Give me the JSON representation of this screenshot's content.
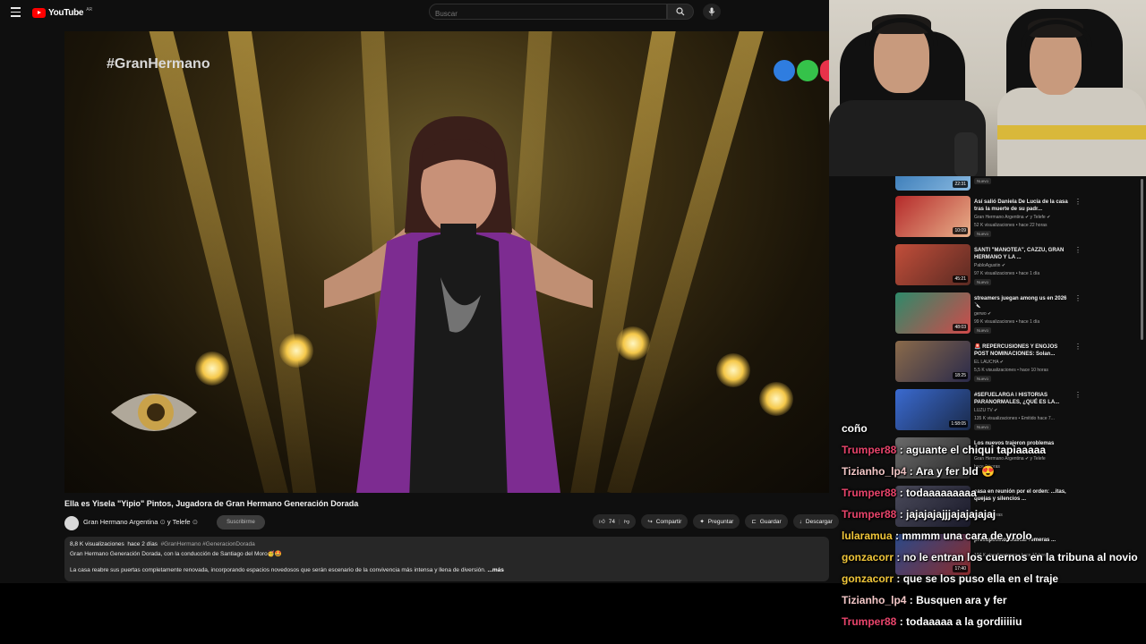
{
  "header": {
    "logo_text": "YouTube",
    "logo_region": "AR",
    "search_placeholder": "Buscar"
  },
  "video": {
    "overlay_hashtag": "#GranHermano",
    "title": "Ella es Yisela \"Yipio\" Pintos, Jugadora de Gran Hermano Generación Dorada",
    "channel": "Gran Hermano Argentina",
    "channel_extra": "y Telefe",
    "subscribe_label": "Suscribirme",
    "likes": "74",
    "share_label": "Compartir",
    "ask_label": "Preguntar",
    "save_label": "Guardar",
    "download_label": "Descargar",
    "views": "8,8 K visualizaciones",
    "age": "hace 2 días",
    "hashtags": "#GranHermano #GeneracionDorada",
    "desc_line1": "Gran Hermano Generación Dorada, con la conducción de Santiago del Moro🥳🤩",
    "desc_line2": "La casa reabre sus puertas completamente renovada, incorporando espacios novedosos que serán escenario de la convivencia más intensa y llena de diversión.",
    "more_label": "...más"
  },
  "recommendations": [
    {
      "title": "",
      "channel": "",
      "stats": "",
      "duration": "22:31",
      "badge": "Nuevo"
    },
    {
      "title": "Así salió Daniela De Lucía de la casa tras la muerte de su padr...",
      "channel": "Gran Hermano Argentina ✔ y Telefe ✔",
      "stats": "52 K visualizaciones • hace 22 horas",
      "duration": "10:09",
      "badge": "Nuevo"
    },
    {
      "title": "SANTI \"MANOTEA\", CAZZU, GRAN HERMANO Y LA ...",
      "channel": "PabloAgustin ✔",
      "stats": "97 K visualizaciones • hace 1 día",
      "duration": "45:21",
      "badge": "Nuevo"
    },
    {
      "title": "streamers juegan among us en 2026 🔪",
      "channel": "gerwo ✔",
      "stats": "99 K visualizaciones • hace 1 día",
      "duration": "48:03",
      "badge": "Nuevo"
    },
    {
      "title": "🚨 REPERCUSIONES Y ENOJOS POST NOMINACIONES: Solan...",
      "channel": "EL LAUCHA ✔",
      "stats": "5,5 K visualizaciones • hace 10 horas",
      "duration": "18:25",
      "badge": "Nuevo"
    },
    {
      "title": "#SEFUELARGA I HISTORIAS PARANORMALES, ¿QUÉ ES LA...",
      "channel": "LUZU TV ✔",
      "stats": "135 K visualizaciones • Emitido hace 7...",
      "duration": "1:58:05",
      "badge": "Nuevo"
    },
    {
      "title": "Los nuevos trajeron problemas",
      "channel": "Gran Hermano Argentina ✔ y Telefe",
      "stats": "hace 9 horas",
      "duration": "",
      "badge": ""
    },
    {
      "title": "casa en reunión por el orden: ...itas, quejas y silencios ...",
      "channel": "",
      "stats": "hace 10 horas",
      "duration": "",
      "badge": ""
    },
    {
      "title": "presupuesto: buscar remeras ...",
      "channel": "",
      "stats": "107 K visualizaciones • hace 10 horas",
      "duration": "17:40",
      "badge": ""
    }
  ],
  "chat": [
    {
      "user": "",
      "message": "coño",
      "color": "#ffffff"
    },
    {
      "user": "Trumper88",
      "message": "aguante el chiqui tapiaaaaa",
      "color": "#e8446b"
    },
    {
      "user": "Tizianho_lp4",
      "message": "Ara y fer bld 😍",
      "color": "#f2c6c6"
    },
    {
      "user": "Trumper88",
      "message": "todaaaaaaaaa",
      "color": "#e8446b"
    },
    {
      "user": "Trumper88",
      "message": "jajajajajjjajajajajaj",
      "color": "#e8446b"
    },
    {
      "user": "lularamua",
      "message": "mmmm una cara de yrolo",
      "color": "#f0c63a"
    },
    {
      "user": "gonzacorr",
      "message": "no le entran los cuernos en la tribuna al novio",
      "color": "#f0c63a"
    },
    {
      "user": "gonzacorr",
      "message": "que se los puso ella en el traje",
      "color": "#f0c63a"
    },
    {
      "user": "Tizianho_lp4",
      "message": "Busquen ara y fer",
      "color": "#f2c6c6"
    },
    {
      "user": "Trumper88",
      "message": "todaaaaa a la gordiiiiiu",
      "color": "#e8446b"
    }
  ],
  "colors": {
    "brand_red": "#ff0000",
    "page_bg": "#0f0f0f",
    "chip_bg": "#272727"
  }
}
